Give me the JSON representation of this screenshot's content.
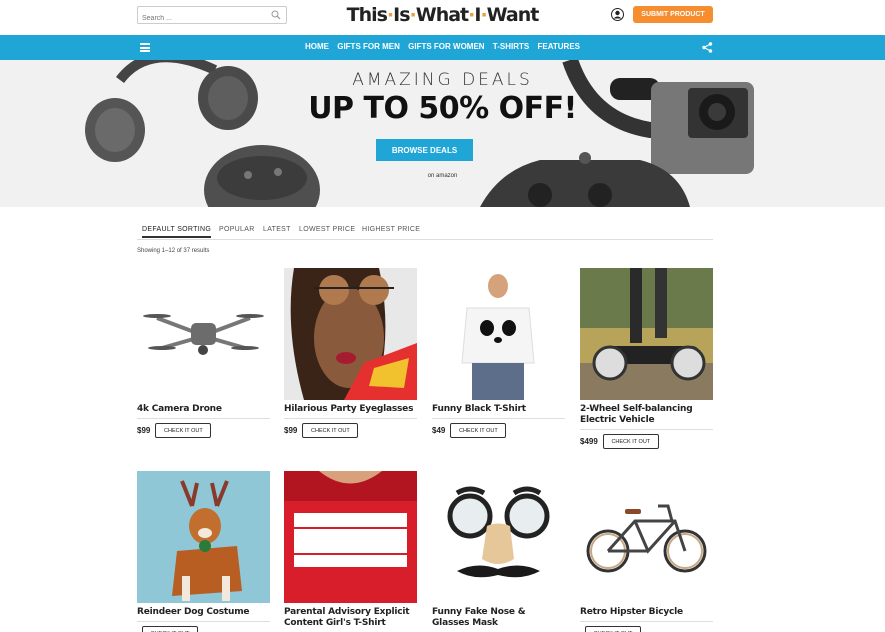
{
  "header": {
    "search_placeholder": "Search ...",
    "logo_parts": [
      "This",
      "·",
      "Is",
      "·",
      "What",
      "·",
      "I",
      "·",
      "Want"
    ],
    "submit_label": "SUBMIT PRODUCT",
    "accent_color": "#f68d2e"
  },
  "nav": {
    "background": "#1fa6d6",
    "items": [
      "HOME",
      "GIFTS FOR MEN",
      "GIFTS FOR WOMEN",
      "T-SHIRTS",
      "FEATURES"
    ]
  },
  "hero": {
    "subtitle": "AMAZING DEALS",
    "title": "UP TO 50% OFF!",
    "button_label": "BROWSE DEALS",
    "note": "on amazon"
  },
  "sorting": {
    "tabs": [
      "DEFAULT SORTING",
      "POPULAR",
      "LATEST",
      "LOWEST PRICE",
      "HIGHEST PRICE"
    ],
    "active": "DEFAULT SORTING",
    "results_text": "Showing 1–12 of 37 results"
  },
  "checkout_label": "CHECK IT OUT",
  "products": [
    {
      "name": "4k Camera Drone",
      "price": "$99"
    },
    {
      "name": "Hilarious Party Eyeglasses",
      "price": "$99"
    },
    {
      "name": "Funny Black T-Shirt",
      "price": "$49"
    },
    {
      "name": "2-Wheel Self-balancing Electric Vehicle",
      "price": "$499"
    },
    {
      "name": "Reindeer Dog Costume",
      "price": ""
    },
    {
      "name": "Parental Advisory Explicit Content Girl's T-Shirt",
      "price": ""
    },
    {
      "name": "Funny Fake Nose & Glasses Mask",
      "price": ""
    },
    {
      "name": "Retro Hipster Bicycle",
      "price": ""
    }
  ],
  "icons": [
    "search-icon",
    "user-icon",
    "hamburger-icon",
    "share-icon"
  ]
}
